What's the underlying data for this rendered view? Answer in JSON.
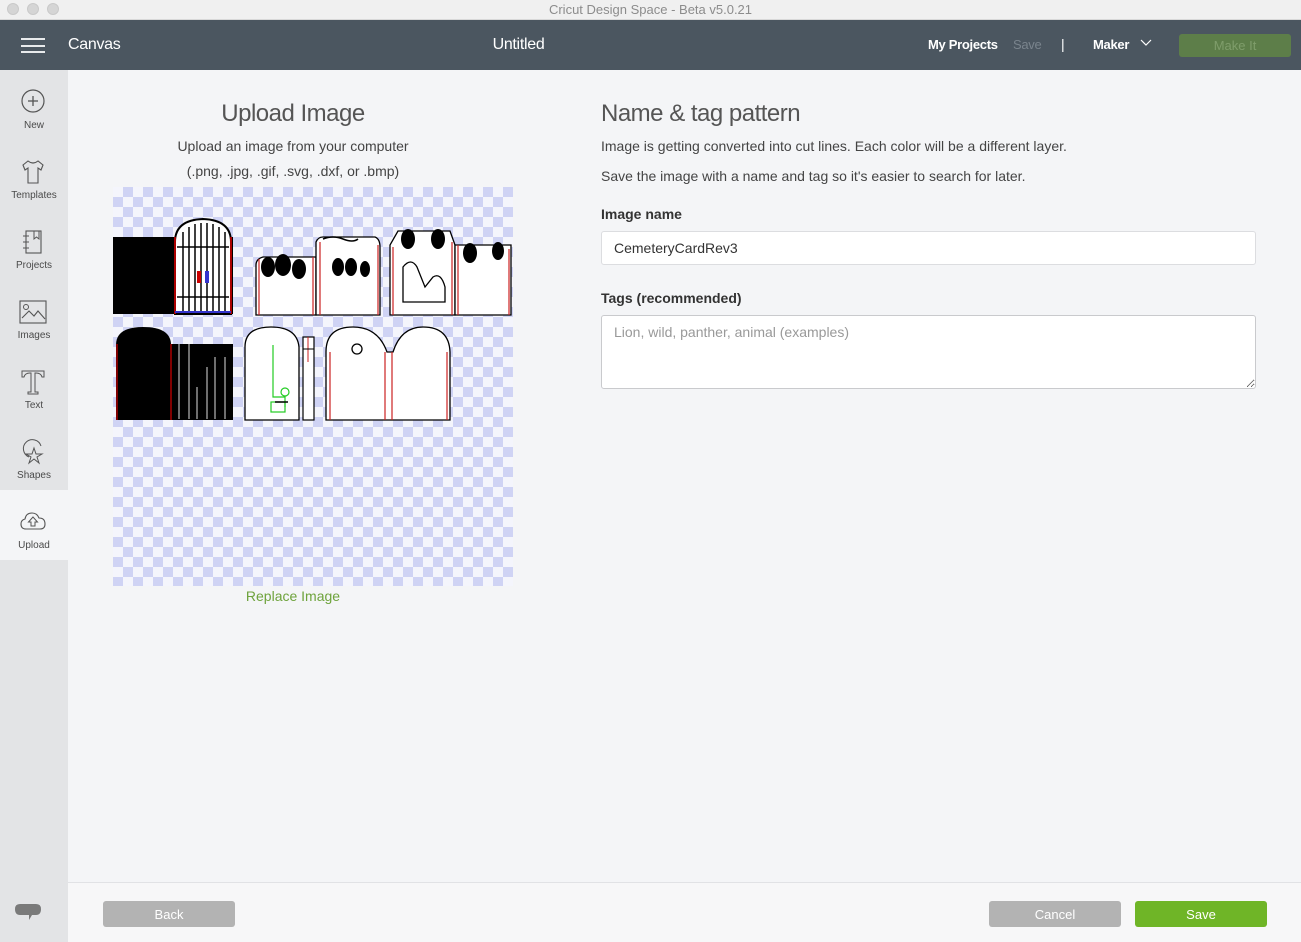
{
  "window": {
    "title": "Cricut Design Space - Beta v5.0.21"
  },
  "header": {
    "section": "Canvas",
    "document_title": "Untitled",
    "my_projects": "My Projects",
    "save": "Save",
    "separator": "|",
    "machine": "Maker",
    "make_it": "Make It",
    "colors": {
      "bar": "#4b5660",
      "make_it": "#5d7e49"
    }
  },
  "sidebar": {
    "items": [
      {
        "label": "New",
        "icon": "plus-circle-icon",
        "active": false
      },
      {
        "label": "Templates",
        "icon": "tshirt-icon",
        "active": false
      },
      {
        "label": "Projects",
        "icon": "notebook-icon",
        "active": false
      },
      {
        "label": "Images",
        "icon": "image-icon",
        "active": false
      },
      {
        "label": "Text",
        "icon": "text-t-icon",
        "active": false
      },
      {
        "label": "Shapes",
        "icon": "shapes-icon",
        "active": false
      },
      {
        "label": "Upload",
        "icon": "cloud-upload-icon",
        "active": true
      }
    ],
    "feedback_icon": "chat-bubble-icon"
  },
  "upload": {
    "title": "Upload Image",
    "subtitle": "Upload an image from your computer",
    "formats": "(.png, .jpg, .gif, .svg, .dxf, or .bmp)",
    "replace_link": "Replace Image",
    "preview_description": "Cemetery card cut pattern: black gate panel with iron gate, tree panels, tree and arch panels, black tombstone with strips, tombstone outlines with green score lines"
  },
  "form": {
    "title": "Name & tag pattern",
    "description_1": "Image is getting converted into cut lines. Each color will be a different layer.",
    "description_2": "Save the image with a name and tag so it's easier to search for later.",
    "image_name_label": "Image name",
    "image_name_value": "CemeteryCardRev3",
    "tags_label": "Tags (recommended)",
    "tags_value": "",
    "tags_placeholder": "Lion, wild, panther, animal (examples)"
  },
  "footer": {
    "back": "Back",
    "cancel": "Cancel",
    "save": "Save",
    "colors": {
      "save": "#6fb527",
      "neutral": "#b3b3b3"
    }
  }
}
